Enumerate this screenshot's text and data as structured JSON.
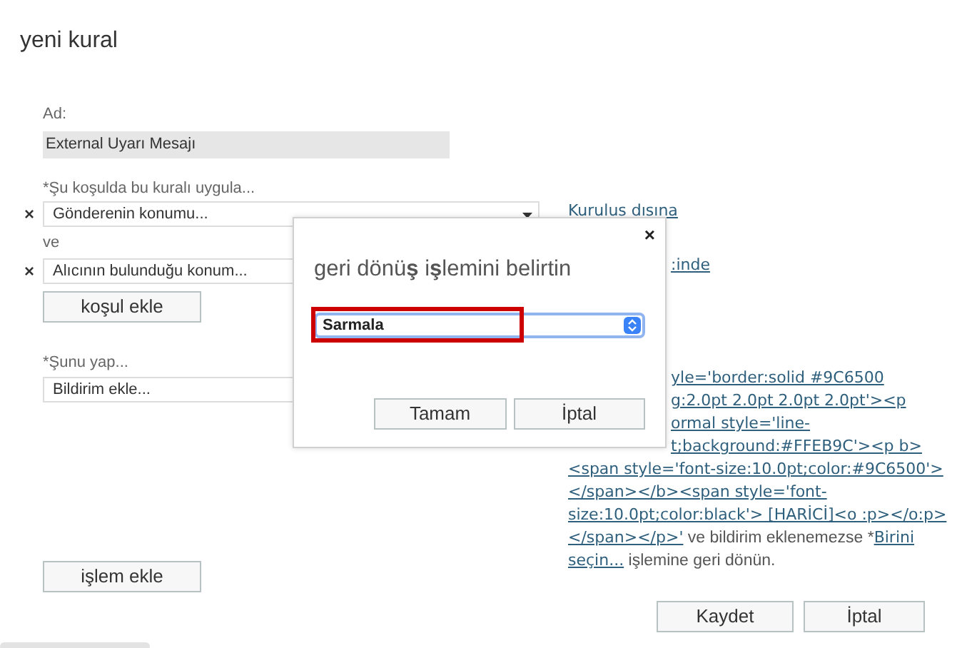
{
  "title": "yeni kural",
  "name_field": {
    "label": "Ad:",
    "value": "External Uyarı Mesajı"
  },
  "condition_section": {
    "label": "*Şu koşulda bu kuralı uygula...",
    "joiner": "ve",
    "add_button": "koşul ekle",
    "conditions": [
      {
        "remove": "×",
        "value": "Gönderenin konumu...",
        "link": "Kurulus dısına"
      },
      {
        "remove": "×",
        "value": "Alıcının bulunduğu konum...",
        "link": ":inde"
      }
    ]
  },
  "action_section": {
    "label": "*Şunu yap...",
    "value": "Bildirim ekle...",
    "add_button": "işlem ekle",
    "code_lines": [
      "yle='border:solid #9C6500",
      "g:2.0pt 2.0pt 2.0pt 2.0pt'><p",
      "ormal style='line-",
      "t;background:#FFEB9C'><p b>",
      "<span style='font-size:10.0pt;color:#9C6500'>",
      "</span></b><span style='font-",
      "size:10.0pt;color:black'> [HARİCİ]<o :p></o:p>"
    ],
    "tail_lines": [
      [
        {
          "kind": "link",
          "text": "</span></p>'"
        },
        {
          "kind": "text",
          "text": " ve bildirim eklenemezse *"
        },
        {
          "kind": "link",
          "text": "Birini"
        }
      ],
      [
        {
          "kind": "link",
          "text": "seçin..."
        },
        {
          "kind": "text",
          "text": " işlemine geri dönün."
        }
      ]
    ]
  },
  "footer_buttons": [
    "Kaydet",
    "İptal"
  ],
  "dialog": {
    "close": "×",
    "title": "geri dönü**ş** i**ş**lemini belirtin",
    "select": {
      "value": "Sarmala",
      "highlighted": true
    },
    "buttons": [
      "Tamam",
      "İptal"
    ]
  }
}
